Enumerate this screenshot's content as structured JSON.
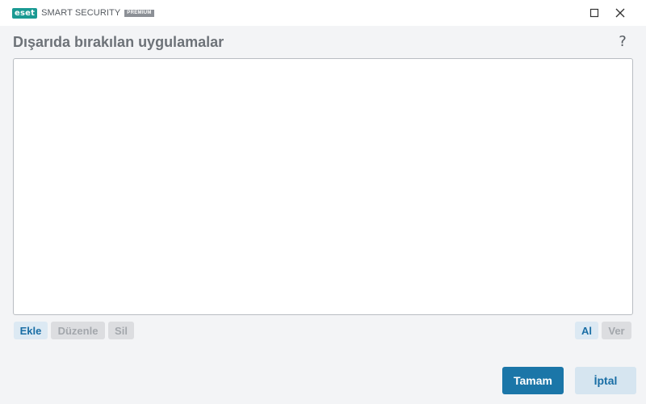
{
  "app": {
    "logo_text": "eset",
    "product_name": "SMART SECURITY",
    "edition": "PREMIUM"
  },
  "window_controls": {
    "maximize_icon": "maximize-icon",
    "close_icon": "close-icon"
  },
  "page": {
    "title": "Dışarıda bırakılan uygulamalar",
    "help_label": "?"
  },
  "list": {
    "items": []
  },
  "toolbar": {
    "add_label": "Ekle",
    "edit_label": "Düzenle",
    "delete_label": "Sil",
    "import_label": "Al",
    "export_label": "Ver"
  },
  "footer": {
    "ok_label": "Tamam",
    "cancel_label": "İptal"
  },
  "colors": {
    "accent": "#1b76a8",
    "brand": "#1a9a93",
    "background": "#f3f4f6",
    "title_text": "#6d7278",
    "disabled_button": "#dcdde0",
    "enabled_light_button": "#dce9f3"
  }
}
